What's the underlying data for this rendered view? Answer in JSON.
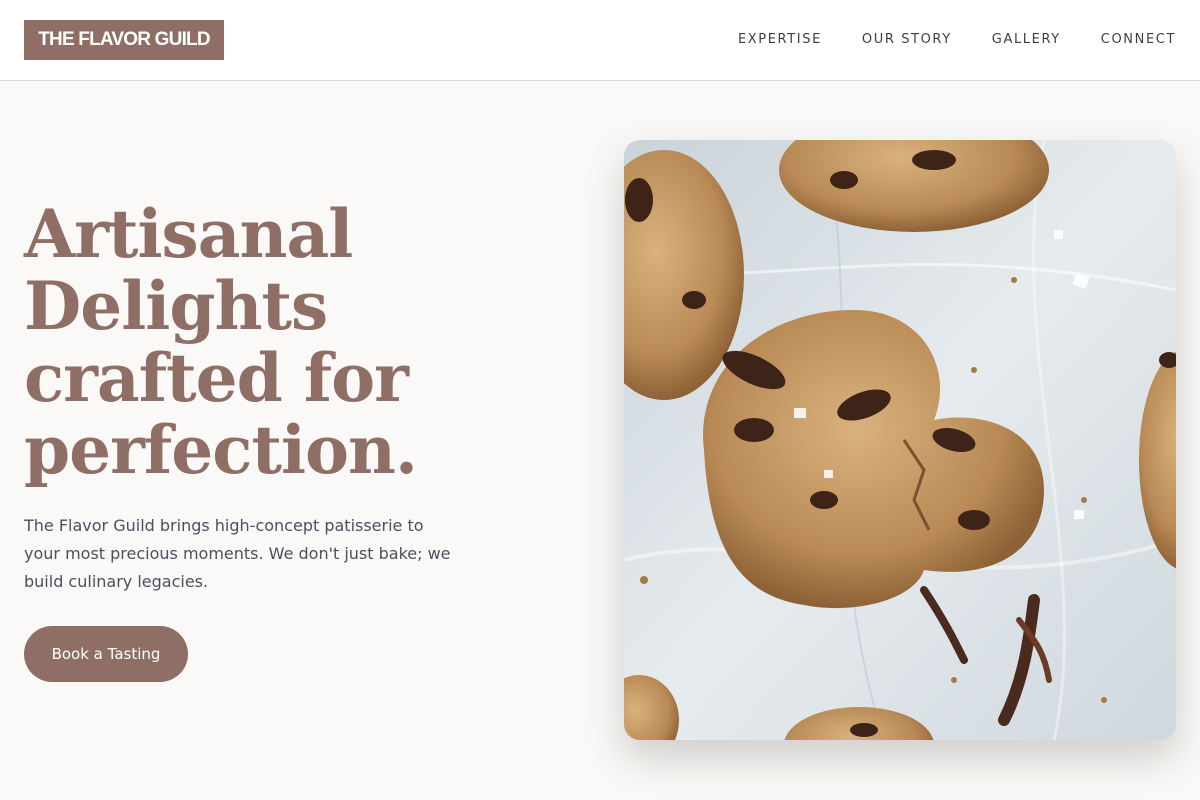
{
  "header": {
    "logo": "THE FLAVOR GUILD",
    "nav": [
      "EXPERTISE",
      "OUR STORY",
      "GALLERY",
      "CONNECT"
    ]
  },
  "hero": {
    "title_lines": [
      "Artisanal",
      "Delights",
      "crafted for",
      "perfection."
    ],
    "description": "The Flavor Guild brings high-concept patisserie to your most precious moments. We don't just bake; we build culinary legacies.",
    "cta_label": "Book a Tasting",
    "image_subject": "chocolate chip cookies on parchment paper"
  },
  "colors": {
    "brand": "#8f6f65",
    "background": "#faf9f7",
    "header_bg": "#ffffff",
    "body_text": "#4a5060"
  }
}
